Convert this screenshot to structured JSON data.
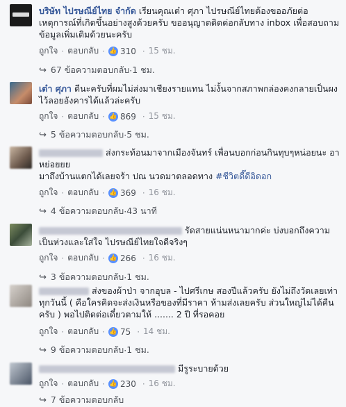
{
  "common": {
    "like_label": "ถูกใจ",
    "reply_label": "ตอบกลับ",
    "separator": "·",
    "reply_arrow": "↪"
  },
  "comments": [
    {
      "author": "บริษัท ไปรษณีย์ไทย จำกัด",
      "text": "เรียนคุณเต๋า ศุภา ไปรษณีย์ไทยต้องขออภัยต่อเหตุการณ์ที่เกิดขึ้นอย่างสูงด้วยครับ ขออนุญาตติดต่อกลับทาง inbox เพื่อสอบถามข้อมูลเพิ่มเติมด้วยนะครับ",
      "likes": "310",
      "time": "15 ชม.",
      "replies": "67 ข้อความตอบกลับ",
      "reply_time": "1 ชม."
    },
    {
      "author": "เต๋า ศุภา",
      "text": "ดีนะครับที่ผมไม่ส่งมาเชียงรายแทน ไม่งั้นจากสภาพกล่องคงกลายเป็นผงไว้ลอยอังคารได้แล้วล่ะครับ",
      "likes": "869",
      "time": "15 ชม.",
      "replies": "5 ข้อความตอบกลับ",
      "reply_time": "5 ชม."
    },
    {
      "text_a": "ส่งกระท้อนมาจากเมืองจันทร์ เพื่อนบอกก่อนกินทุบๆหน่อยนะ อาหย่อยยย",
      "text_b": "มาถึงบ้านแตกได้เลยจร้า ปณ นวดมาตลอดทาง",
      "hashtag": "#ชีวิตดี๊ดีอิดอก",
      "likes": "369",
      "time": "16 ชม.",
      "replies": "4 ข้อความตอบกลับ",
      "reply_time": "43 นาที"
    },
    {
      "text": "รัดสายแน่นหนามากค่ะ บ่งบอกถึงความเป็นห่วงและใส่ใจ ไปรษณีย์ไทยใจดีจริงๆ",
      "likes": "266",
      "time": "16 ชม.",
      "replies": "3 ข้อความตอบกลับ",
      "reply_time": "1 ชม."
    },
    {
      "text": "ส่งของผ้าป่า จากอุบล - ไปศรีเกษ สองปีแล้วครับ ยังไม่ถึงวัดเลยเท่าทุกวันนี้ ( คือใครคิดจะส่งเงินหรือของที่มีราคา ห้ามส่งเลยครับ ส่วนใหญ่ไม่ได้คืนครับ ) พอไปติดต่อเดี๋ยวตามให้ ....... 2 ปี ที่รอคอย",
      "likes": "75",
      "time": "14 ชม.",
      "replies": "9 ข้อความตอบกลับ",
      "reply_time": "1 ชม."
    },
    {
      "text": "มีรูระบายด้วย",
      "likes": "230",
      "time": "16 ชม.",
      "replies": "7 ข้อความตอบกลับ",
      "reply_time": ""
    }
  ]
}
